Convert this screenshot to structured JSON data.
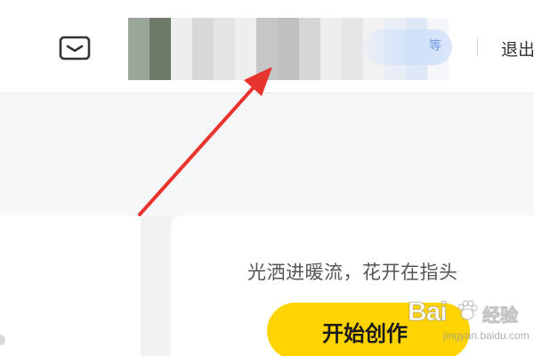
{
  "header": {
    "mail_icon": "mail-icon",
    "user_badge_glyph": "等",
    "logout_label": "退出"
  },
  "creator_card": {
    "slogan": "光洒进暖流，花开在指头",
    "create_button_label": "开始创作"
  },
  "annotation": {
    "color": "#e8342e"
  },
  "watermark": {
    "brand": "Bai",
    "brand_suffix": "经验",
    "url": "jingyan.baidu.com"
  },
  "colors": {
    "accent_yellow": "#ffd400",
    "page_background": "#f6f7f8",
    "arrow_red": "#e8342e"
  }
}
